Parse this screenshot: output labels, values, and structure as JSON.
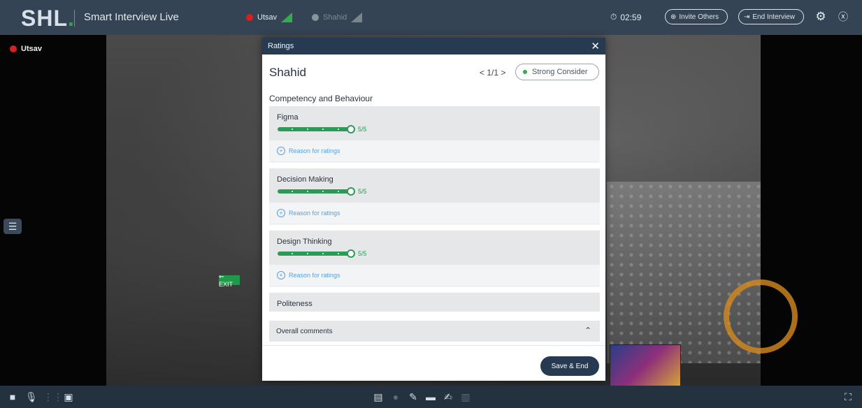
{
  "app": {
    "logo": "SHL",
    "logo_dot": ".",
    "name": "Smart Interview Live"
  },
  "participants": [
    {
      "name": "Utsav",
      "status": "recording",
      "signal": "good"
    },
    {
      "name": "Shahid",
      "status": "inactive",
      "signal": "none"
    }
  ],
  "topbar": {
    "timer": "02:59",
    "invite_label": "Invite Others",
    "end_label": "End Interview"
  },
  "video": {
    "speaker_label": "Utsav",
    "exit_sign": "⇐ EXIT"
  },
  "modal": {
    "title": "Ratings",
    "candidate": "Shahid",
    "pager": "< 1/1 >",
    "status": "Strong Consider",
    "section_title": "Competency and Behaviour",
    "competencies": [
      {
        "name": "Figma",
        "score": "5/5",
        "fraction": 1.0,
        "reason_label": "Reason for ratings"
      },
      {
        "name": "Decision Making",
        "score": "5/5",
        "fraction": 1.0,
        "reason_label": "Reason for ratings"
      },
      {
        "name": "Design Thinking",
        "score": "5/5",
        "fraction": 1.0,
        "reason_label": "Reason for ratings"
      },
      {
        "name": "Politeness"
      }
    ],
    "comments_label": "Overall comments",
    "save_label": "Save & End"
  },
  "colors": {
    "topbar": "#344454",
    "accent_green": "#2b9a56",
    "modal_header": "#263a52",
    "link_blue": "#5aa0d8",
    "record_red": "#d72020"
  }
}
